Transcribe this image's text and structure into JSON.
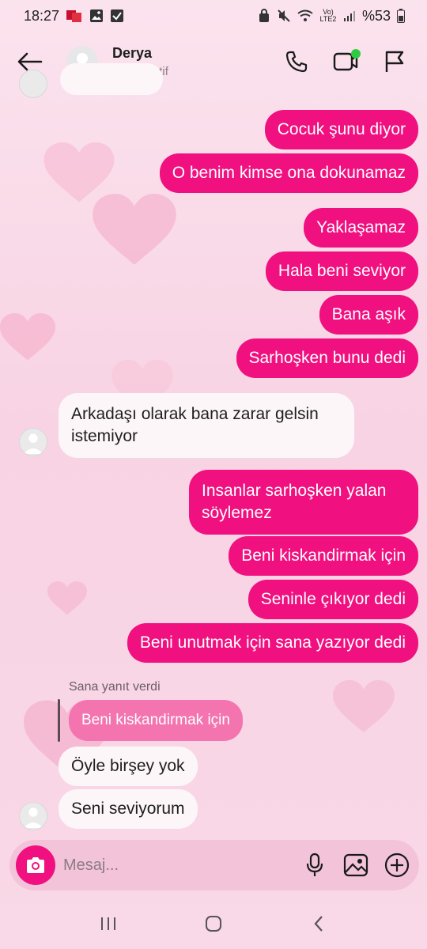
{
  "status_bar": {
    "time": "18:27",
    "battery": "%53",
    "network": "Vo) LTE2"
  },
  "header": {
    "contact_name": "Derya",
    "contact_status": "Şu an aktif"
  },
  "messages": [
    {
      "direction": "out",
      "text": "Cocuk şunu diyor"
    },
    {
      "direction": "out",
      "text": "O benim kimse ona dokunamaz"
    },
    {
      "direction": "out",
      "text": "Yaklaşamaz"
    },
    {
      "direction": "out",
      "text": "Hala beni seviyor"
    },
    {
      "direction": "out",
      "text": "Bana aşık"
    },
    {
      "direction": "out",
      "text": "Sarhoşken bunu dedi"
    },
    {
      "direction": "in",
      "text": "Arkadaşı olarak bana zarar gelsin istemiyor"
    },
    {
      "direction": "out",
      "text": "Insanlar sarhoşken yalan söylemez"
    },
    {
      "direction": "out",
      "text": "Beni kiskandirmak için"
    },
    {
      "direction": "out",
      "text": "Seninle çıkıyor dedi"
    },
    {
      "direction": "out",
      "text": "Beni unutmak için sana yazıyor dedi"
    },
    {
      "direction": "in",
      "text": "Öyle birşey yok"
    },
    {
      "direction": "in",
      "text": "Seni seviyorum"
    }
  ],
  "reply": {
    "label": "Sana yanıt verdi",
    "quoted_text": "Beni kiskandirmak için"
  },
  "composer": {
    "placeholder": "Mesaj..."
  },
  "colors": {
    "accent": "#f0107f",
    "reply_bubble": "#f474b0",
    "background": "#f9d8e7",
    "online": "#2ecc40"
  },
  "icons": {
    "back": "arrow-left-icon",
    "call": "phone-icon",
    "video": "video-call-icon",
    "report": "flag-icon",
    "camera": "camera-icon",
    "mic": "microphone-icon",
    "gallery": "image-icon",
    "add": "plus-circle-icon"
  }
}
